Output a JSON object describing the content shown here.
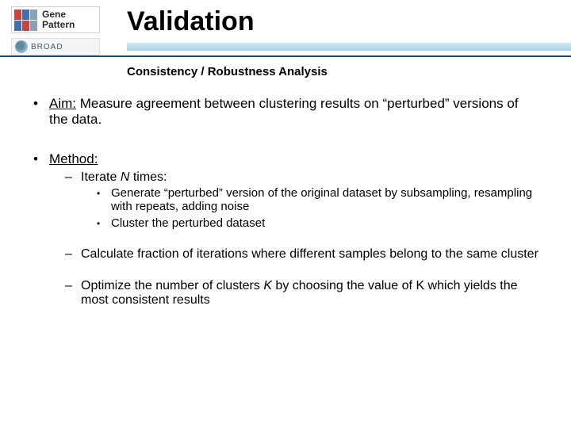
{
  "header": {
    "logo1_line1": "Gene",
    "logo1_line2": "Pattern",
    "logo2_text": "BROAD",
    "title": "Validation"
  },
  "subtitle": "Consistency / Robustness Analysis",
  "bullets": {
    "aim_label": "Aim:",
    "aim_text": " Measure agreement between clustering results on “perturbed” versions of the data.",
    "method_label": "Method:",
    "method": {
      "iterate_prefix": "Iterate ",
      "iterate_var": "N",
      "iterate_suffix": " times:",
      "iterate_sub1": "Generate “perturbed” version of the original dataset by subsampling, resampling with repeats, adding noise",
      "iterate_sub2": "Cluster the perturbed dataset",
      "calc": "Calculate fraction of iterations where different samples belong to the same cluster",
      "optimize_prefix": "Optimize the number of clusters ",
      "optimize_var": "K",
      "optimize_suffix": " by choosing the value of K which yields the most consistent results"
    }
  }
}
